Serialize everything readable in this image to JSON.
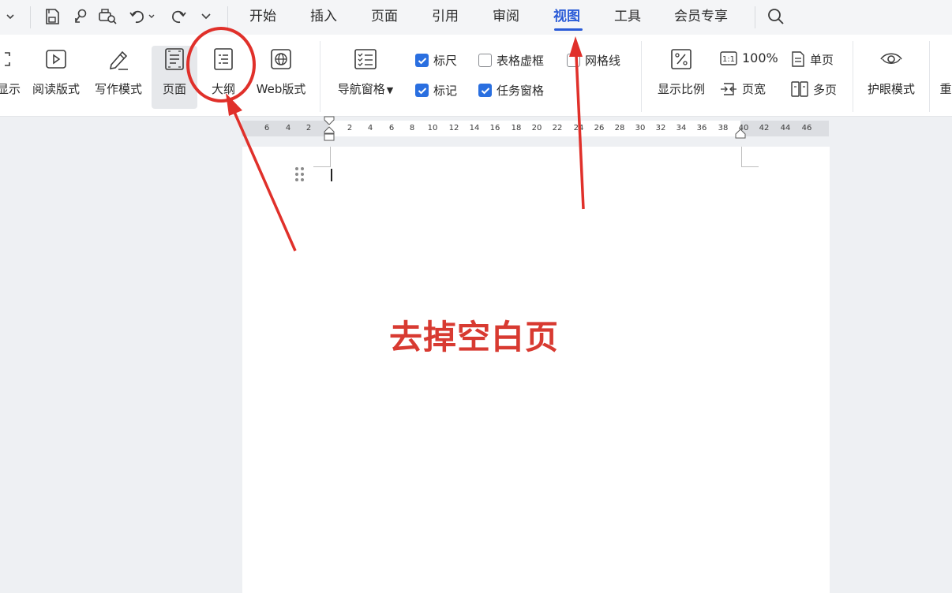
{
  "tabs": [
    "开始",
    "插入",
    "页面",
    "引用",
    "审阅",
    "视图",
    "工具",
    "会员专享"
  ],
  "active_tab": "视图",
  "ribbon": {
    "view_buttons": [
      "显示",
      "阅读版式",
      "写作模式",
      "页面",
      "大纲",
      "Web版式"
    ],
    "selected_view": "页面",
    "nav_pane": "导航窗格",
    "checkboxes": [
      {
        "label": "标尺",
        "checked": true
      },
      {
        "label": "表格虚框",
        "checked": false
      },
      {
        "label": "网格线",
        "checked": false
      },
      {
        "label": "标记",
        "checked": true
      },
      {
        "label": "任务窗格",
        "checked": true
      }
    ],
    "zoom_label": "显示比例",
    "zoom_100": "100%",
    "page_width": "页宽",
    "single_page": "单页",
    "multi_page": "多页",
    "eye_mode": "护眼模式",
    "cut_off_label": "重"
  },
  "ruler": {
    "left_ticks": [
      "6",
      "4",
      "2"
    ],
    "right_ticks": [
      "2",
      "4",
      "6",
      "8",
      "10",
      "12",
      "14",
      "16",
      "18",
      "20",
      "22",
      "24",
      "26",
      "28",
      "30",
      "32",
      "34",
      "36",
      "38",
      "40",
      "42",
      "44",
      "46"
    ]
  },
  "document": {
    "overlay_text": "去掉空白页"
  },
  "colors": {
    "accent": "#2a5bd7",
    "checkbox": "#2a6fe0",
    "annotation_red": "#e0302a",
    "title_red": "#d83a31"
  }
}
